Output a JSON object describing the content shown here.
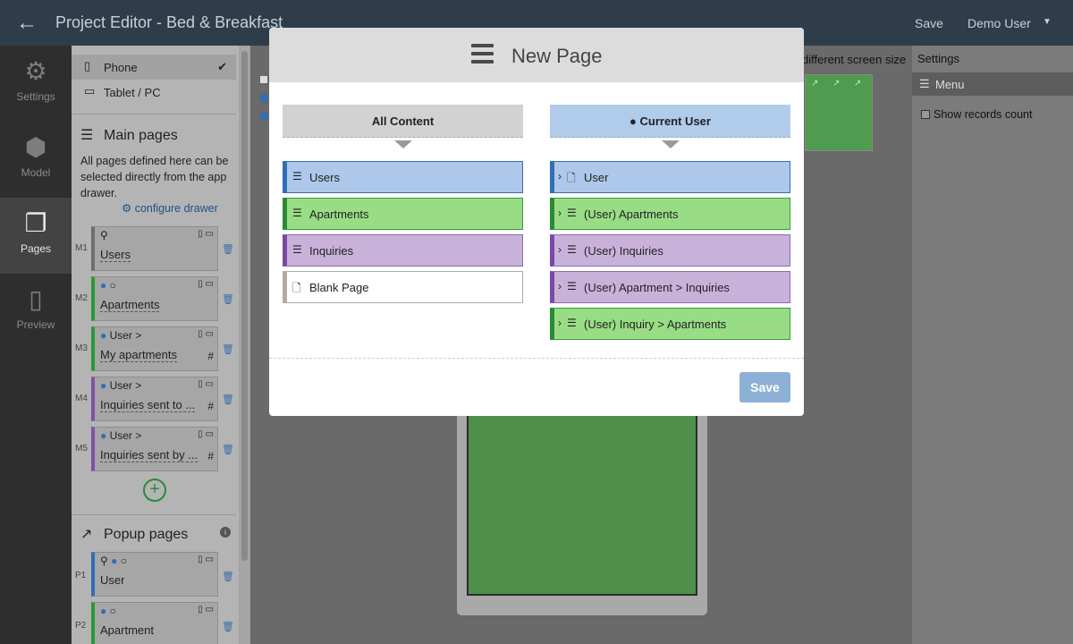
{
  "topbar": {
    "title": "Project Editor - Bed & Breakfast",
    "save_label": "Save",
    "user_label": "Demo User"
  },
  "leftnav": {
    "items": [
      {
        "label": "Settings",
        "icon": "gear-icon"
      },
      {
        "label": "Model",
        "icon": "cube-icon"
      },
      {
        "label": "Pages",
        "icon": "pages-icon",
        "active": true
      },
      {
        "label": "Preview",
        "icon": "tablet-icon"
      }
    ]
  },
  "panel": {
    "devices": [
      {
        "label": "Phone",
        "selected": true
      },
      {
        "label": "Tablet / PC",
        "selected": false
      }
    ],
    "main_pages_title": "Main pages",
    "main_pages_desc": "All pages defined here can be selected directly from the app drawer.",
    "configure_drawer": "configure drawer",
    "main_pages": [
      {
        "code": "M1",
        "meta": "",
        "name": "Users",
        "hash": ""
      },
      {
        "code": "M2",
        "meta": "",
        "name": "Apartments",
        "hash": ""
      },
      {
        "code": "M3",
        "meta": "User >",
        "name": "My apartments",
        "hash": "#"
      },
      {
        "code": "M4",
        "meta": "User >",
        "name": "Inquiries sent to ...",
        "hash": "#"
      },
      {
        "code": "M5",
        "meta": "User >",
        "name": "Inquiries sent by ...",
        "hash": "#"
      }
    ],
    "popup_pages_title": "Popup pages",
    "popup_pages": [
      {
        "code": "P1",
        "name": "User"
      },
      {
        "code": "P2",
        "name": "Apartment"
      }
    ]
  },
  "canvas": {
    "hint": "different screen size"
  },
  "settings": {
    "title": "Settings",
    "menu_label": "Menu",
    "show_records_count": "Show records count"
  },
  "modal": {
    "title": "New Page",
    "left_header": "All Content",
    "right_header": "Current User",
    "left_options": [
      {
        "label": "Users",
        "color": "blue",
        "icon": "list-icon"
      },
      {
        "label": "Apartments",
        "color": "green",
        "icon": "list-icon"
      },
      {
        "label": "Inquiries",
        "color": "purple",
        "icon": "list-icon"
      },
      {
        "label": "Blank Page",
        "color": "white",
        "icon": "page-icon"
      }
    ],
    "right_options": [
      {
        "label": "User",
        "color": "blue",
        "icon": "page-icon"
      },
      {
        "label": "(User) Apartments",
        "color": "green",
        "icon": "list-icon"
      },
      {
        "label": "(User) Inquiries",
        "color": "purple",
        "icon": "list-icon"
      },
      {
        "label": "(User) Apartment > Inquiries",
        "color": "purple",
        "icon": "list-icon"
      },
      {
        "label": "(User) Inquiry > Apartments",
        "color": "green",
        "icon": "list-icon"
      }
    ],
    "save_label": "Save"
  }
}
